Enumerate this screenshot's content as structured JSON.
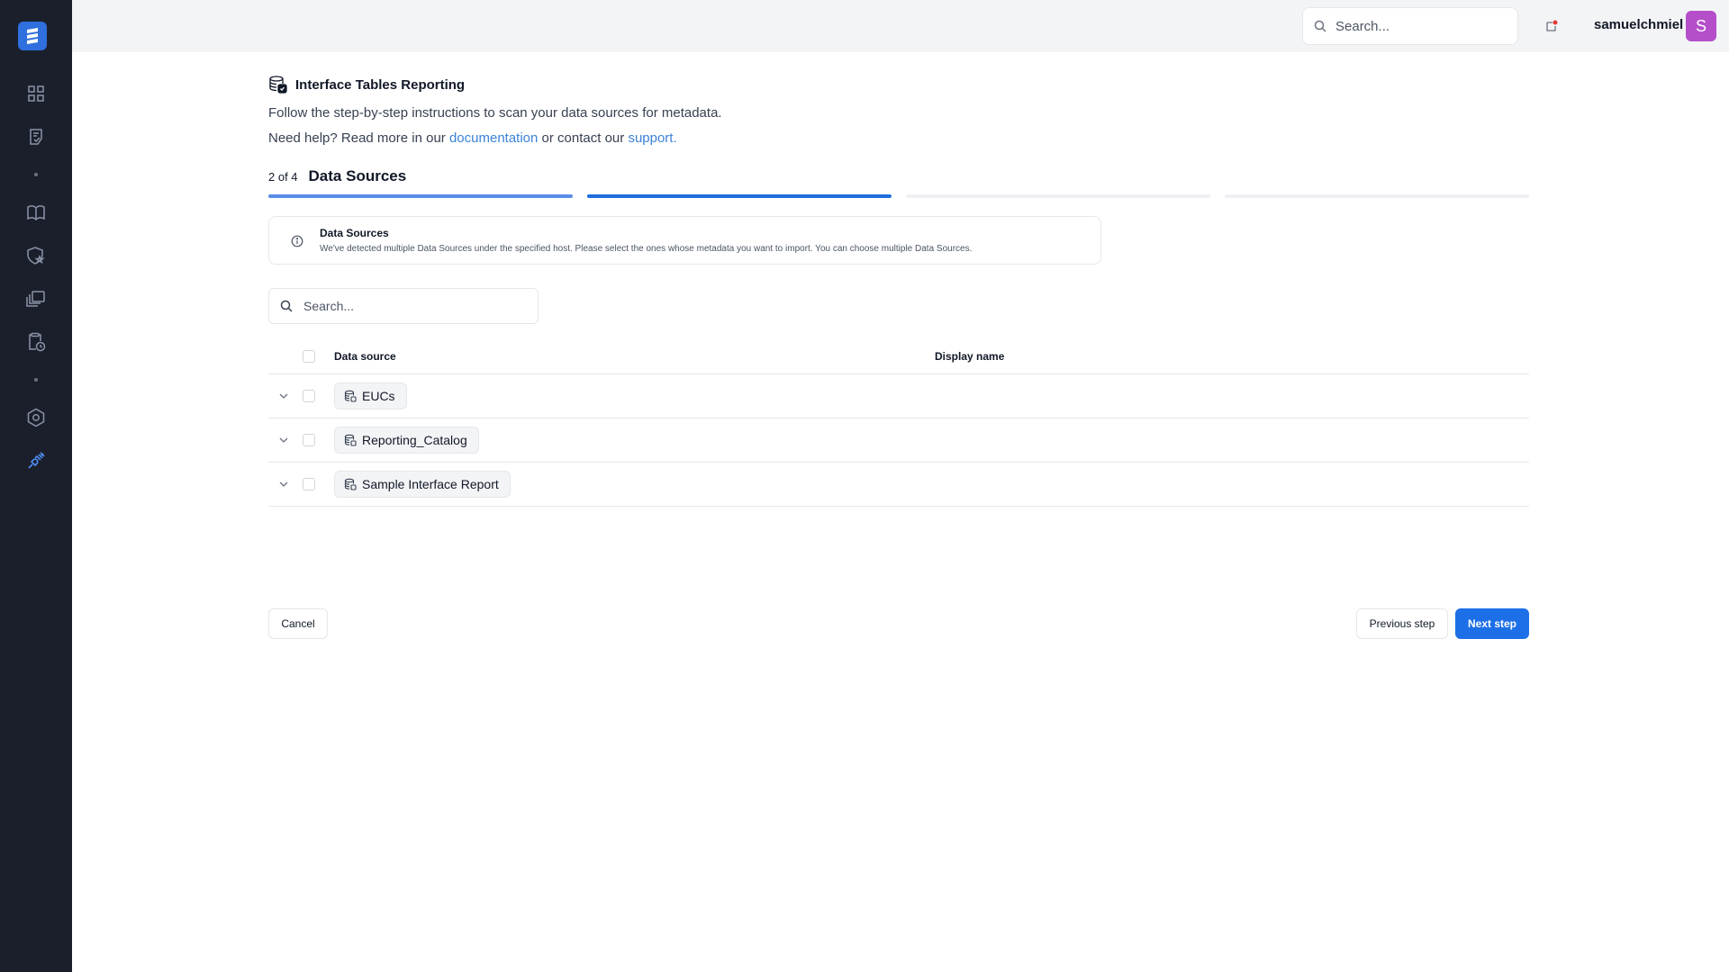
{
  "topbar": {
    "search_placeholder": "Search...",
    "username": "samuelchmiel",
    "avatar_initial": "S"
  },
  "sidebar": {
    "items": [
      {
        "icon": "dashboard-icon"
      },
      {
        "icon": "checklist-icon"
      },
      {
        "icon": "book-icon"
      },
      {
        "icon": "shield-star-icon"
      },
      {
        "icon": "layers-icon"
      },
      {
        "icon": "clipboard-clock-icon"
      },
      {
        "icon": "hexagon-settings-icon"
      },
      {
        "icon": "integration-plug-icon"
      }
    ],
    "accent_color": "#2f6fde"
  },
  "page": {
    "title": "Interface Tables Reporting",
    "description": "Follow the step-by-step instructions to scan your data sources for metadata.",
    "help_prefix": "Need help? Read more in our ",
    "help_link1": "documentation",
    "help_middle": " or contact our ",
    "help_link2": "support."
  },
  "step": {
    "count": "2 of 4",
    "name": "Data Sources",
    "current": 2,
    "total": 4
  },
  "info": {
    "title": "Data Sources",
    "text": "We've detected multiple Data Sources under the specified host. Please select the ones whose metadata you want to import. You can choose multiple Data Sources."
  },
  "list": {
    "search_placeholder": "Search...",
    "columns": {
      "data_source": "Data source",
      "display_name": "Display name"
    },
    "rows": [
      {
        "name": "EUCs",
        "display_name": ""
      },
      {
        "name": "Reporting_Catalog",
        "display_name": ""
      },
      {
        "name": "Sample Interface Report",
        "display_name": ""
      }
    ]
  },
  "footer": {
    "cancel": "Cancel",
    "previous": "Previous step",
    "next": "Next step"
  }
}
